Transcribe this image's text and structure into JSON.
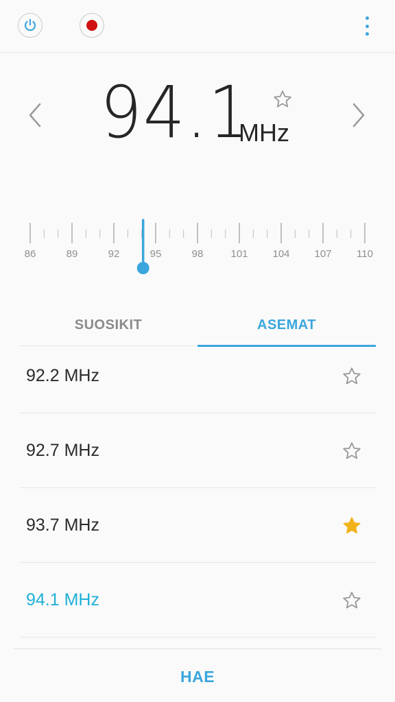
{
  "topbar": {
    "power_icon": "power-icon",
    "record_icon": "record-icon",
    "more_icon": "more-vertical-icon",
    "accent_color": "#3aa6dc",
    "record_color": "#d01111"
  },
  "tuner": {
    "frequency": "94.1",
    "unit": "MHz",
    "favorite": false
  },
  "dial": {
    "min": 86,
    "max": 110,
    "current": 94.1,
    "labels": [
      "86",
      "89",
      "92",
      "95",
      "98",
      "101",
      "104",
      "107",
      "110"
    ]
  },
  "tabs": [
    {
      "label": "SUOSIKIT",
      "active": false
    },
    {
      "label": "ASEMAT",
      "active": true
    }
  ],
  "stations": [
    {
      "label": "92.2 MHz",
      "favorite": false,
      "active": false
    },
    {
      "label": "92.7 MHz",
      "favorite": false,
      "active": false
    },
    {
      "label": "93.7 MHz",
      "favorite": true,
      "active": false
    },
    {
      "label": "94.1 MHz",
      "favorite": false,
      "active": true
    }
  ],
  "bottom": {
    "scan_label": "HAE"
  },
  "colors": {
    "accent": "#3aa6dc",
    "active_station": "#1fb0d8",
    "favorite_star": "#f2b21b",
    "outline_star": "#9a9a9a"
  }
}
